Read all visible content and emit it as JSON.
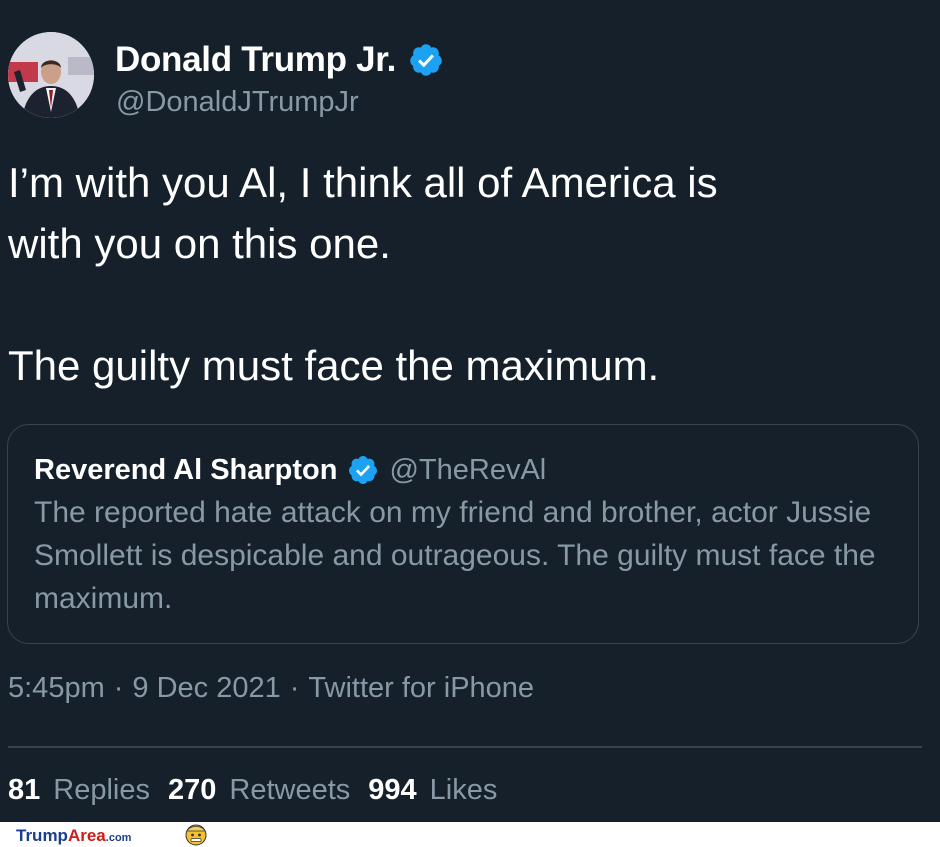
{
  "tweet": {
    "author": {
      "name": "Donald Trump Jr.",
      "handle": "@DonaldJTrumpJr",
      "verified": true
    },
    "text": "I’m with you Al, I think all of America is\nwith you on this one.\n\nThe guilty must face the maximum.",
    "quoted": {
      "name": "Reverend Al Sharpton",
      "handle": "@TheRevAl",
      "verified": true,
      "text": "The reported hate attack on my friend and brother, actor Jussie Smollett is despicable and outrageous. The guilty must face the maximum."
    },
    "time": "5:45pm",
    "date": "9 Dec 2021",
    "source": "Twitter for iPhone",
    "separator": "·",
    "stats": {
      "replies_count": "81",
      "replies_label": "Replies",
      "retweets_count": "270",
      "retweets_label": "Retweets",
      "likes_count": "994",
      "likes_label": "Likes"
    }
  },
  "watermark": {
    "logo_text": "TrumpArea.com"
  },
  "colors": {
    "background": "#15202b",
    "secondary_text": "#8899a6",
    "border": "#38444d",
    "verified_blue": "#1da1f2",
    "watermark_red": "#d11a1a",
    "watermark_blue": "#1a3f8f"
  },
  "icons": {
    "verified": "verified-badge-icon",
    "watermark_face": "trump-face-icon"
  }
}
